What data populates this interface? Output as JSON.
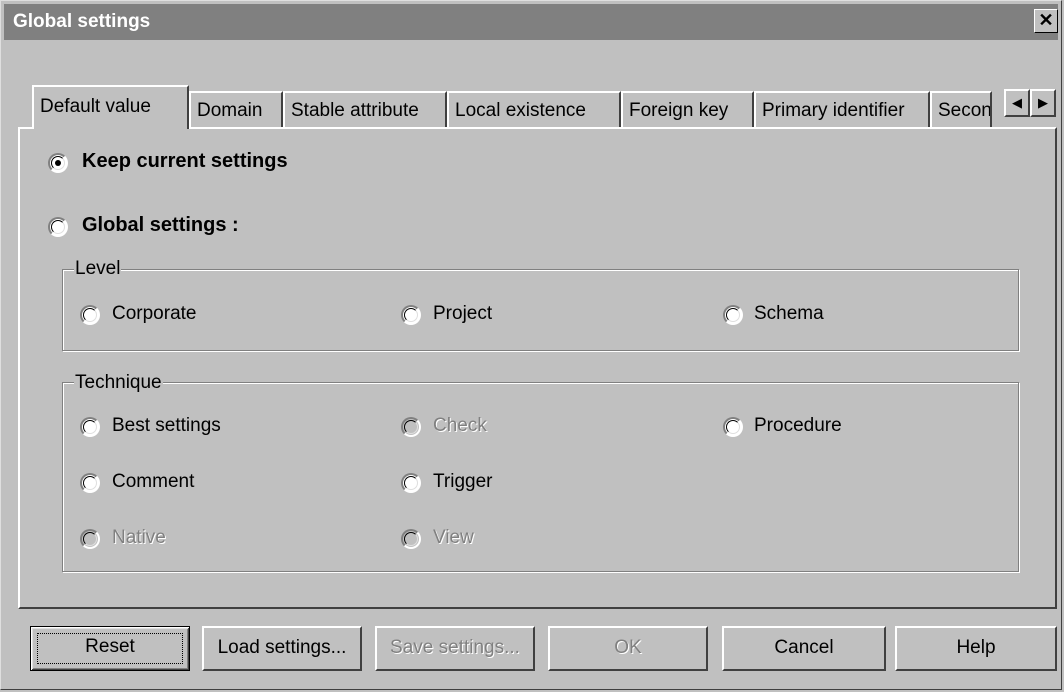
{
  "window": {
    "title": "Global settings"
  },
  "tabs": [
    {
      "label": "Default value"
    },
    {
      "label": "Domain"
    },
    {
      "label": "Stable attribute"
    },
    {
      "label": "Local existence"
    },
    {
      "label": "Foreign key"
    },
    {
      "label": "Primary identifier"
    },
    {
      "label": "Secondary identifier"
    }
  ],
  "mode": {
    "keep_label": "Keep current settings",
    "global_label": "Global settings :",
    "selected": "keep"
  },
  "level": {
    "legend": "Level",
    "options": [
      "Corporate",
      "Project",
      "Schema"
    ]
  },
  "technique": {
    "legend": "Technique",
    "options": [
      {
        "label": "Best settings",
        "enabled": true
      },
      {
        "label": "Check",
        "enabled": false
      },
      {
        "label": "Procedure",
        "enabled": true
      },
      {
        "label": "Comment",
        "enabled": true
      },
      {
        "label": "Trigger",
        "enabled": true
      },
      {
        "label": "Native",
        "enabled": false
      },
      {
        "label": "View",
        "enabled": false
      }
    ]
  },
  "buttons": {
    "reset": "Reset",
    "load": "Load settings...",
    "save": "Save settings...",
    "ok": "OK",
    "cancel": "Cancel",
    "help": "Help"
  },
  "icons": {
    "close": "close-icon",
    "scroll_left": "arrow-left-icon",
    "scroll_right": "arrow-right-icon"
  }
}
